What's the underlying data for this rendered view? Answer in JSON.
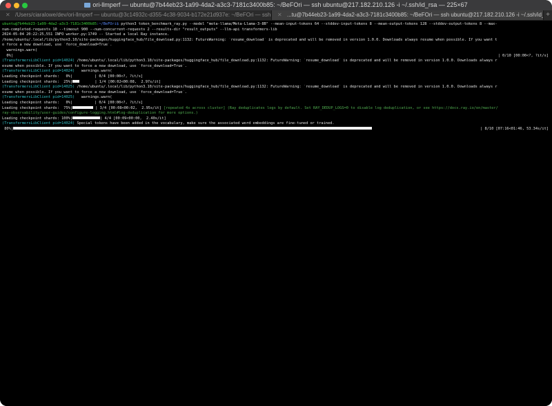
{
  "window": {
    "title": "ori-llmperf — ubuntu@7b44eb23-1a99-4da2-a3c3-7181c3400b85: ~/BeFOri — ssh ubuntu@217.182.210.126 -i ~/.ssh/id_rsa — 225×67"
  },
  "tabs": [
    {
      "label": "/Users/ciaralowe/dev/ori-llmperf — ubuntu@3c14932c-d355-4c38-9034-b172e21d937e: ~/BeFOri — ssh",
      "active": false
    },
    {
      "label": "...tu@7b44eb23-1a99-4da2-a3c3-7181c3400b85: ~/BeFOri — ssh ubuntu@217.182.210.126 -i ~/.ssh/id_rsa",
      "active": true
    }
  ],
  "terminal": {
    "prompt_user": "ubuntu@7b44eb23-1a99-4da2-a3c3-7181c3400b85",
    "prompt_path": ":~/BeFOri$",
    "command": " python3 token_benchmark_ray.py --model \"meta-llama/Meta-Llama-3-8B\" --mean-input-tokens 64 --stddev-input-tokens 8 --mean-output-tokens 128 --stddev-output-tokens 8 --max-",
    "line_cmd2": "num-completed-requests 10 --timeout 900 --num-concurrent-requests 2 --results-dir \"result_outputs\" --llm-api transformers-lib",
    "line_log": "2024-05-04 20:22:25,551 INFO worker.py:1749 -- Started a local Ray instance.",
    "line_warn1": "/home/ubuntu/.local/lib/python3.10/site-packages/huggingface_hub/file_download.py:1132: FutureWarning: `resume_download` is deprecated and will be removed in version 1.0.0. Downloads always resume when possible. If you want t",
    "line_warn1b": "o force a new download, use `force_download=True`.",
    "line_warnings": "  warnings.warn(",
    "line_p0_left": "  0%|",
    "line_p0_right": "| 0/10 [00:00<?, ?it/s]",
    "pid_a": "(TransformersLibClient pid=14024)",
    "line_warn2": " /home/ubuntu/.local/lib/python3.10/site-packages/huggingface_hub/file_download.py:1132: FutureWarning: `resume_download` is deprecated and will be removed in version 1.0.0. Downloads always r",
    "line_warn2b": "esume when possible. If you want to force a new download, use `force_download=True`.",
    "line_warnings2": "   warnings.warn(",
    "line_ckpt1": "Loading checkpoint shards:   0%|          | 0/4 [00:00<?, ?it/s]",
    "line_ckpt2_a": "Loading checkpoint shards:  25%|",
    "line_ckpt2_b": "       | 1/4 [00:02<00:08,  2.97s/it]",
    "pid_b": "(TransformersLibClient pid=14025)",
    "line_warn3": " /home/ubuntu/.local/lib/python3.10/site-packages/huggingface_hub/file_download.py:1132: FutureWarning: `resume_download` is deprecated and will be removed in version 1.0.0. Downloads always r",
    "line_warn3b": "esume when possible. If you want to force a new download, use `force_download=True`.",
    "line_warnings3": "   warnings.warn(",
    "line_ckpt3": "Loading checkpoint shards:   0%|          | 0/4 [00:00<?, ?it/s]",
    "line_ckpt4_a": "Loading checkpoint shards:  75%|",
    "line_ckpt4_b": " | 3/4 [00:08<00:02,  2.95s/it] ",
    "line_ckpt4_c": "[repeated 4x across cluster] (Ray deduplicates logs by default. Set RAY_DEDUP_LOGS=0 to disable log deduplication, or see https://docs.ray.io/en/master/",
    "line_ckpt4_d": "ray-observability/user-guides/configure-logging.html#log-deduplication for more options.)",
    "line_ckpt5_a": "Loading checkpoint shards: 100%|",
    "line_ckpt5_b": "| 4/4 [00:09<00:00,  2.40s/it]",
    "pid_c": "(TransformersLibClient pid=14024)",
    "line_special": " Special tokens have been added in the vocabulary, make sure the associated word embeddings are fine-tuned or trained.",
    "line_p80_left": " 80%|",
    "line_p80_right": "| 8/10 [07:16<01:46, 53.34s/it]",
    "progress": {
      "ckpt_25": 0.25,
      "ckpt_75": 0.75,
      "ckpt_100": 1.0,
      "requests_80": 0.8
    }
  }
}
